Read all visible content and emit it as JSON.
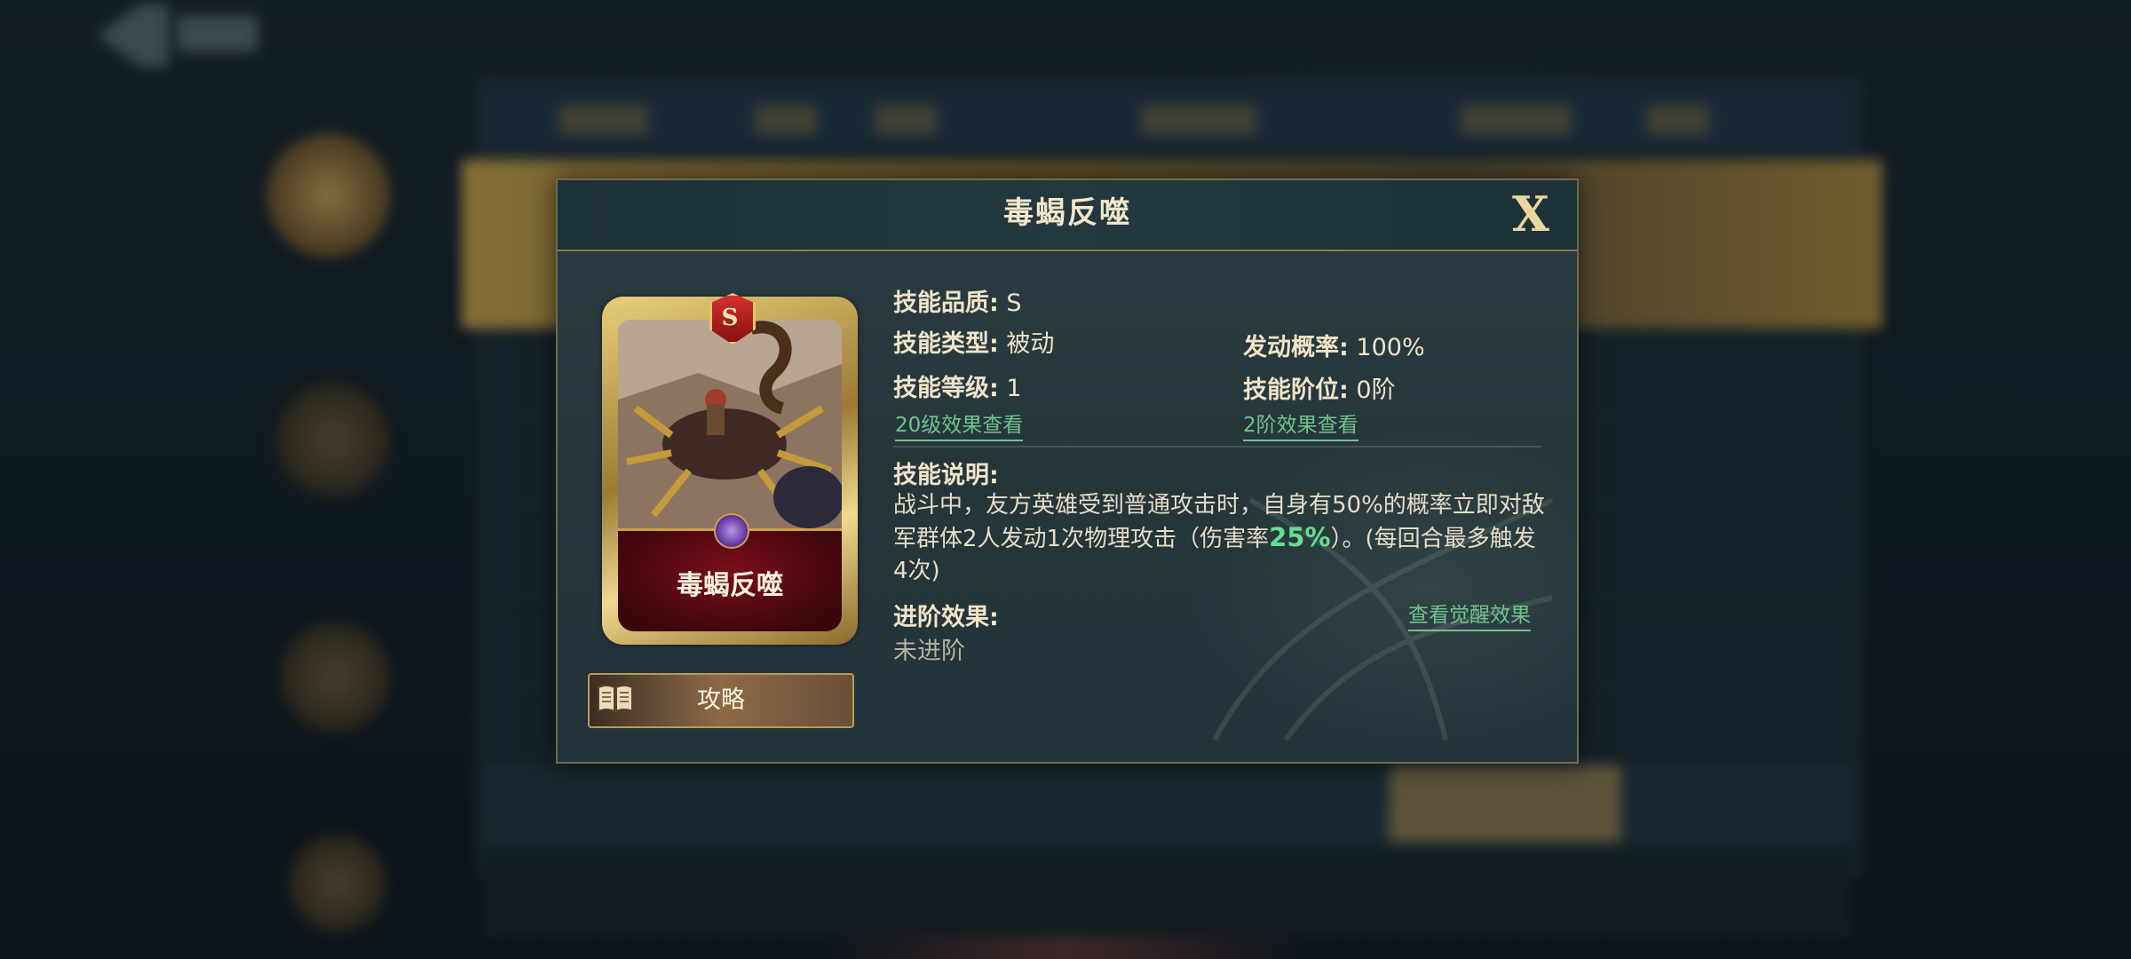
{
  "popup": {
    "title": "毒蝎反噬",
    "close_label": "X"
  },
  "card": {
    "grade_badge": "S",
    "name": "毒蝎反噬"
  },
  "guide_button": {
    "label": "攻略",
    "icon": "book-icon"
  },
  "skill": {
    "quality_label": "技能品质:",
    "quality_value": "S",
    "type_label": "技能类型:",
    "type_value": "被动",
    "trigger_label": "发动概率:",
    "trigger_value": "100%",
    "level_label": "技能等级:",
    "level_value": "1",
    "rank_label": "技能阶位:",
    "rank_value": "0阶",
    "level_link": "20级效果查看",
    "rank_link": "2阶效果查看",
    "desc_label": "技能说明:",
    "desc_part1": "战斗中，友方英雄受到普通攻击时，自身有50%的概率立即对敌军群体2人发动1次物理攻击（伤害率",
    "desc_highlight": "25%",
    "desc_part2": "）。(每回合最多触发4次)",
    "advance_label": "进阶效果:",
    "advance_value": "未进阶",
    "awaken_link": "查看觉醒效果"
  },
  "colors": {
    "accent_gold": "#e9d79f",
    "link_green": "#6fc38c",
    "highlight_green": "#63e08c",
    "card_red": "#7a0e1a"
  }
}
